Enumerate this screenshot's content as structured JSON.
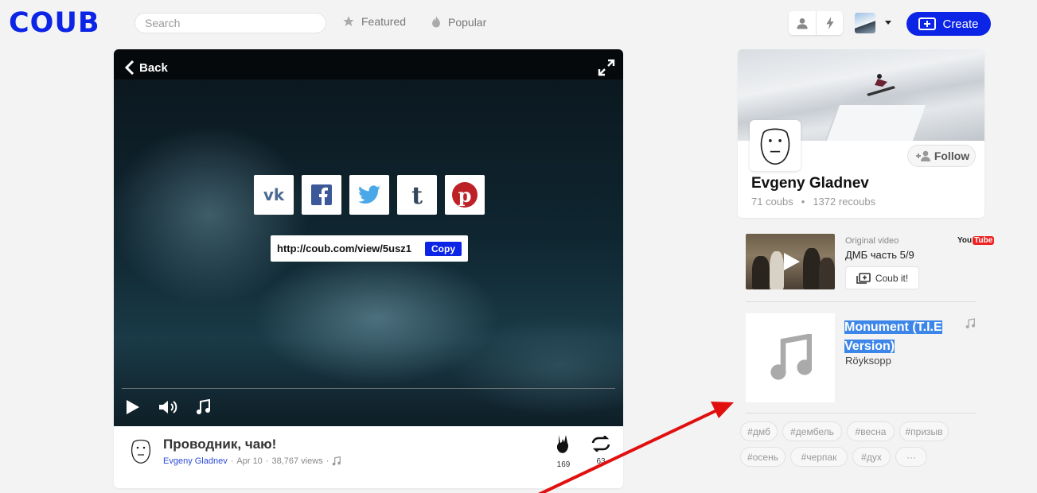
{
  "header": {
    "logo": "COUB",
    "search_placeholder": "Search",
    "nav": [
      {
        "label": "Featured",
        "icon": "star-icon"
      },
      {
        "label": "Popular",
        "icon": "flame-icon"
      }
    ],
    "create_label": "Create",
    "brand_color": "#0b24e6"
  },
  "player": {
    "back_label": "Back",
    "share_url": "http://coub.com/view/5usz1",
    "copy_label": "Copy",
    "share_targets": [
      "vk",
      "facebook",
      "twitter",
      "tumblr",
      "pinterest"
    ]
  },
  "coub": {
    "title": "Проводник, чаю!",
    "author": "Evgeny Gladnev",
    "date": "Apr 10",
    "views": "38,767 views",
    "likes": "169",
    "recoubs": "63"
  },
  "profile": {
    "name": "Evgeny Gladnev",
    "coubs": "71 coubs",
    "recoubs": "1372 recoubs",
    "follow_label": "Follow"
  },
  "original_video": {
    "label": "Original video",
    "title": "ДМБ часть 5/9",
    "source": "YouTube",
    "coub_it_label": "Coub it!"
  },
  "music": {
    "song": "Monument (T.I.E Version)",
    "artist": "Röyksopp"
  },
  "tags": [
    "#дмб",
    "#дембель",
    "#весна",
    "#призыв",
    "#осень",
    "#черпак",
    "#дух",
    "···"
  ]
}
